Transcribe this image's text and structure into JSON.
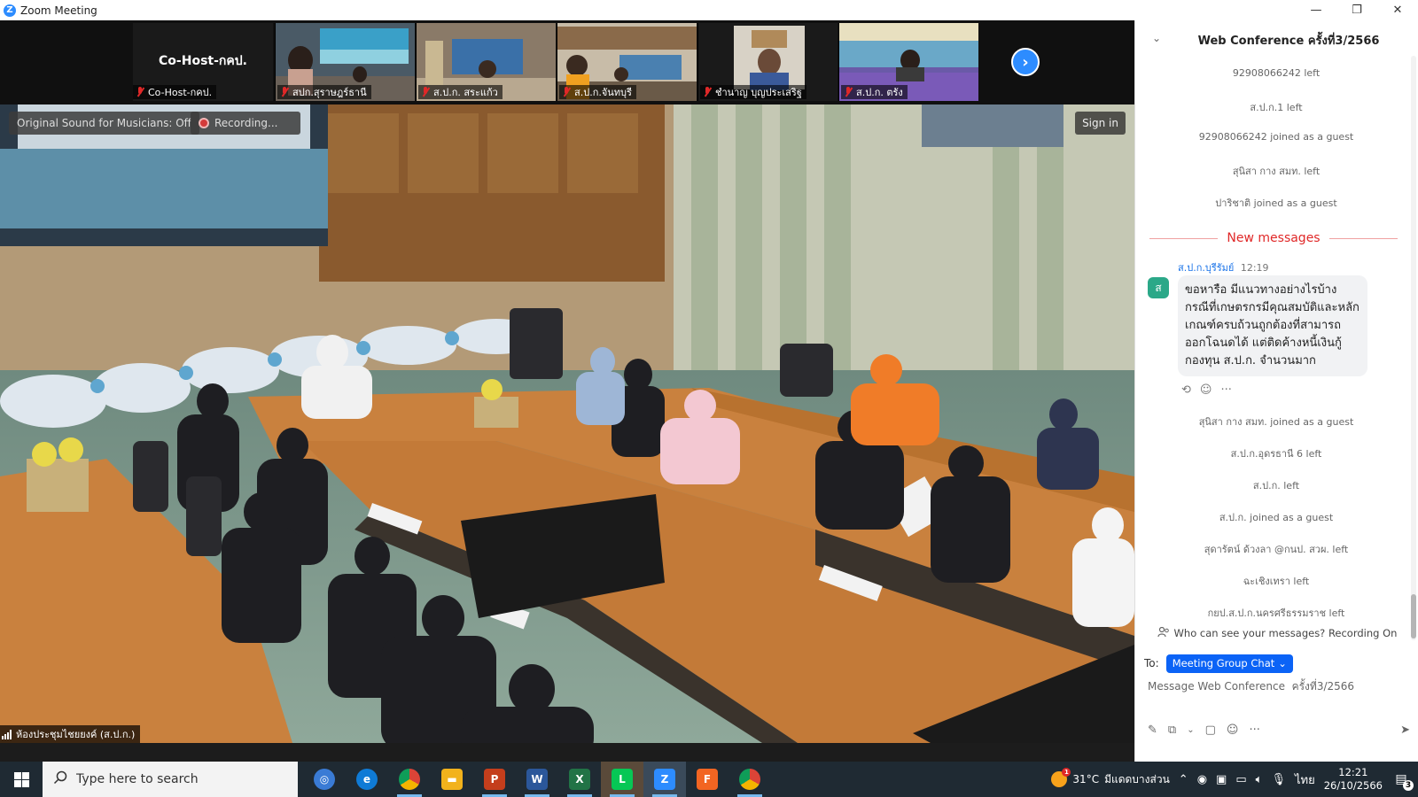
{
  "window": {
    "title": "Zoom Meeting",
    "logo_letter": "Z",
    "minimize": "—",
    "restore": "❐",
    "close": "✕"
  },
  "gallery": {
    "cohost_big": "Co-Host-กคป.",
    "tiles": [
      {
        "label": "Co-Host-กคป."
      },
      {
        "label": "สปก.สุราษฎร์ธานี"
      },
      {
        "label": "ส.ป.ก. สระแก้ว"
      },
      {
        "label": "ส.ป.ก.จันทบุรี"
      },
      {
        "label": "ชำนาญ บุญประเสริฐ"
      },
      {
        "label": "ส.ป.ก. ตรัง"
      }
    ],
    "next_glyph": "›"
  },
  "main_video": {
    "original_sound": "Original Sound for Musicians: Off",
    "recording": "Recording...",
    "sign_in": "Sign in",
    "room_label": "ห้องประชุมไชยยงค์ (ส.ป.ก.)"
  },
  "chat": {
    "title": "Web Conference  ครั้งที่3/2566",
    "collapse_glyph": "⌄",
    "system_before": [
      "92908066242 left",
      "ส.ป.ก.1 left",
      "92908066242 joined as a guest",
      "สุนิสา กาง สมท. left",
      "ปาริชาติ joined as a guest"
    ],
    "new_messages": "New messages",
    "message": {
      "avatar": "ส",
      "sender": "ส.ป.ก.บุรีรัมย์",
      "time": "12:19",
      "text": "ขอหารือ มีแนวทางอย่างไรบ้าง กรณีที่เกษตรกรมีคุณสมบัติและหลักเกณฑ์ครบถ้วนถูกต้องที่สามารถออกโฉนดได้ แต่ติดค้างหนี้เงินกู้กองทุน ส.ป.ก. จำนวนมาก",
      "action_reply": "⟲",
      "action_react": "☺",
      "action_more": "···"
    },
    "system_after": [
      "สุนิสา กาง สมท. joined as a guest",
      "ส.ป.ก.อุดรธานี 6 left",
      "ส.ป.ก. left",
      "ส.ป.ก. joined as a guest",
      "สุดารัตน์ ด้วงลา @กนป. สวผ. left",
      "ฉะเชิงเทรา left",
      "กยป.ส.ป.ก.นครศรีธรรมราช left"
    ],
    "privacy": "Who can see your messages? Recording On",
    "to_label": "To:",
    "to_value": "Meeting Group Chat",
    "input_placeholder": "Message Web Conference  ครั้งที่3/2566"
  },
  "taskbar": {
    "search_placeholder": "Type here to search",
    "apps": [
      {
        "name": "widgets",
        "color": "#3a7bd5",
        "glyph": "◎"
      },
      {
        "name": "edge",
        "color": "#0f7bd6",
        "glyph": "e"
      },
      {
        "name": "chrome",
        "color": "#d9412f",
        "glyph": "●"
      },
      {
        "name": "file-explorer",
        "color": "#f2b21c",
        "glyph": "▬"
      },
      {
        "name": "powerpoint",
        "color": "#c43e1c",
        "glyph": "P"
      },
      {
        "name": "word",
        "color": "#2b579a",
        "glyph": "W"
      },
      {
        "name": "excel",
        "color": "#217346",
        "glyph": "X"
      },
      {
        "name": "line",
        "color": "#06c755",
        "glyph": "L"
      },
      {
        "name": "zoom",
        "color": "#2d8cff",
        "glyph": "Z"
      },
      {
        "name": "foxit",
        "color": "#f26522",
        "glyph": "F"
      },
      {
        "name": "chrome-2",
        "color": "#d9412f",
        "glyph": "●"
      }
    ],
    "weather_temp": "31°C",
    "weather_text": "มีแดดบางส่วน",
    "weather_badge": "1",
    "language": "ไทย",
    "time": "12:21",
    "date": "26/10/2566",
    "notifications": "3"
  }
}
